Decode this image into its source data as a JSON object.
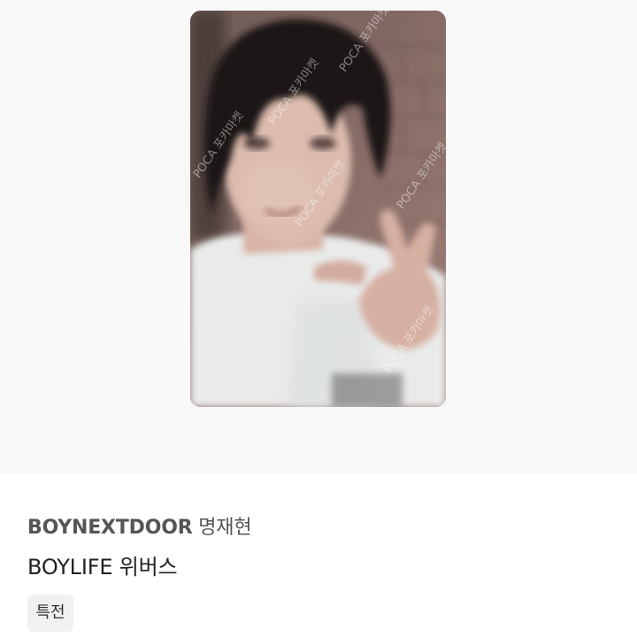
{
  "product": {
    "image": {
      "icon": "photocard-image",
      "watermark_text": "POCA 포카마켓"
    },
    "artist": "BOYNEXTDOOR",
    "member": "명재현",
    "album": "BOYLIFE",
    "store": "위버스",
    "tag": "특전"
  },
  "colors": {
    "image_background": "#f8f8f8",
    "tag_background": "#f1f1f1",
    "text_primary": "#222222",
    "text_secondary": "#555555"
  }
}
